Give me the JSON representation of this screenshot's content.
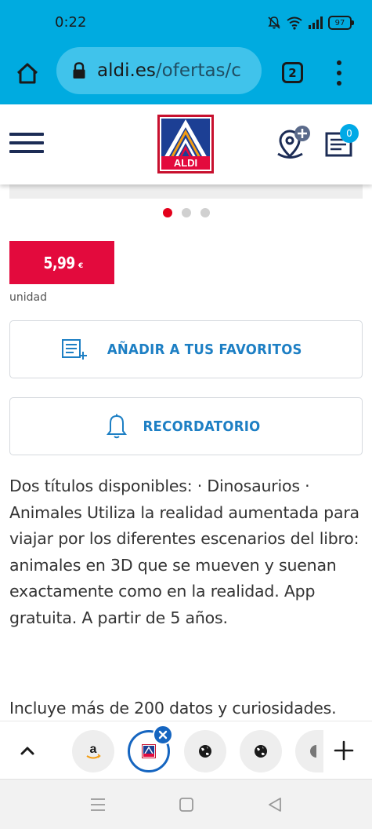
{
  "status_bar": {
    "time": "0:22",
    "battery": "97"
  },
  "browser": {
    "url_host": "aldi.es",
    "url_path": "/ofertas/c",
    "tab_count": "2",
    "accent_color": "#00abe0"
  },
  "site_header": {
    "logo_text": "ALDI",
    "list_badge_count": "0"
  },
  "carousel": {
    "total_dots": 3,
    "active_index": 0
  },
  "product": {
    "price": "5,99",
    "currency": "€",
    "unit": "unidad",
    "price_color": "#e30a3d"
  },
  "actions": {
    "favorites_label": "AÑADIR A TUS FAVORITOS",
    "reminder_label": "RECORDATORIO",
    "label_color": "#1d7fc4"
  },
  "description": {
    "paragraph_1": "Dos títulos disponibles: · Dinosaurios · Animales Utiliza la realidad aumentada para viajar por los diferentes escenarios del libro: animales en 3D que se mueven y suenan exactamente como en la realidad. App gratuita. A partir de 5 años.",
    "paragraph_2": "Incluye más de 200 datos y curiosidades."
  },
  "tab_strip": {
    "tabs": [
      {
        "icon": "amazon-icon"
      },
      {
        "icon": "aldi-logo-icon",
        "current": true
      },
      {
        "icon": "globe-icon"
      },
      {
        "icon": "globe-icon"
      },
      {
        "icon": "globe-icon"
      }
    ]
  }
}
